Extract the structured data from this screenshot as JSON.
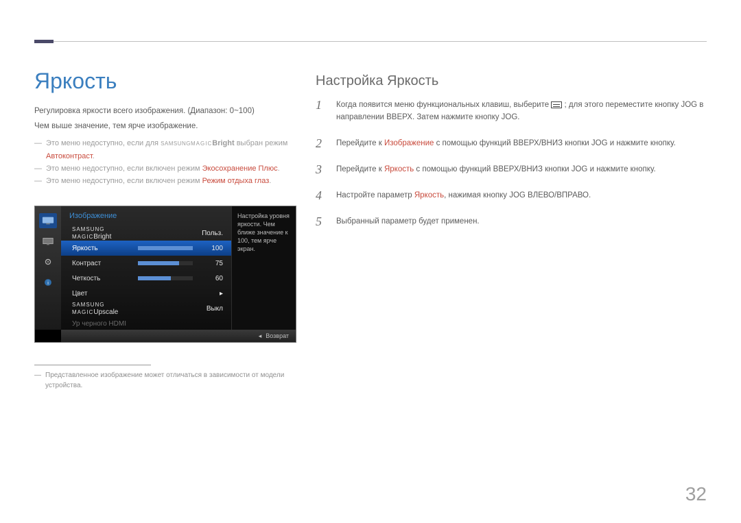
{
  "page_number": "32",
  "left": {
    "title": "Яркость",
    "desc_line1": "Регулировка яркости всего изображения. (Диапазон: 0~100)",
    "desc_line2": "Чем выше значение, тем ярче изображение.",
    "bullets": [
      {
        "prefix": "Это меню недоступно, если для ",
        "logo_small": "SAMSUNG",
        "logo_mid": "MAGIC",
        "logo_bold": "Bright",
        "mid": " выбран режим ",
        "hl": "Автоконтраст",
        "suffix": "."
      },
      {
        "prefix": "Это меню недоступно, если включен режим ",
        "hl": "Экосохранение Плюс",
        "suffix": "."
      },
      {
        "prefix": "Это меню недоступно, если включен режим ",
        "hl": "Режим отдыха глаз",
        "suffix": "."
      }
    ],
    "footnote": "Представленное изображение может отличаться в зависимости от модели устройства."
  },
  "osd": {
    "section_title": "Изображение",
    "rows": {
      "magic_bright": {
        "label_small": "SAMSUNG",
        "label_mid": "MAGIC",
        "label_suffix": "Bright",
        "value": "Польз."
      },
      "brightness": {
        "label": "Яркость",
        "value": "100",
        "fill_pct": 100
      },
      "contrast": {
        "label": "Контраст",
        "value": "75",
        "fill_pct": 75
      },
      "sharpness": {
        "label": "Четкость",
        "value": "60",
        "fill_pct": 60
      },
      "color": {
        "label": "Цвет"
      },
      "magic_upscale": {
        "label_small": "SAMSUNG",
        "label_mid": "MAGIC",
        "label_suffix": "Upscale",
        "value": "Выкл"
      },
      "hdmi_black": {
        "label": "Ур черного HDMI"
      }
    },
    "help": "Настройка уровня яркости. Чем ближе значение к 100, тем ярче экран.",
    "return_label": "Возврат",
    "side_icons": {
      "picture": "picture-icon",
      "display": "display-icon",
      "settings": "settings-icon",
      "info": "info-icon"
    }
  },
  "right": {
    "title": "Настройка Яркость",
    "steps": [
      {
        "n": "1",
        "pre": "Когда появится меню функциональных клавиш, выберите ",
        "glyph": true,
        "post": " ; для этого переместите кнопку JOG в направлении ВВЕРХ. Затем нажмите кнопку JOG."
      },
      {
        "n": "2",
        "pre": "Перейдите к ",
        "hl": "Изображение",
        "post": " с помощью функций ВВЕРХ/ВНИЗ кнопки JOG и нажмите кнопку."
      },
      {
        "n": "3",
        "pre": "Перейдите к ",
        "hl": "Яркость",
        "post": " с помощью функций ВВЕРХ/ВНИЗ кнопки JOG и нажмите кнопку."
      },
      {
        "n": "4",
        "pre": "Настройте параметр ",
        "hl": "Яркость",
        "post": ", нажимая кнопку JOG ВЛЕВО/ВПРАВО."
      },
      {
        "n": "5",
        "pre": "Выбранный параметр будет применен."
      }
    ]
  }
}
